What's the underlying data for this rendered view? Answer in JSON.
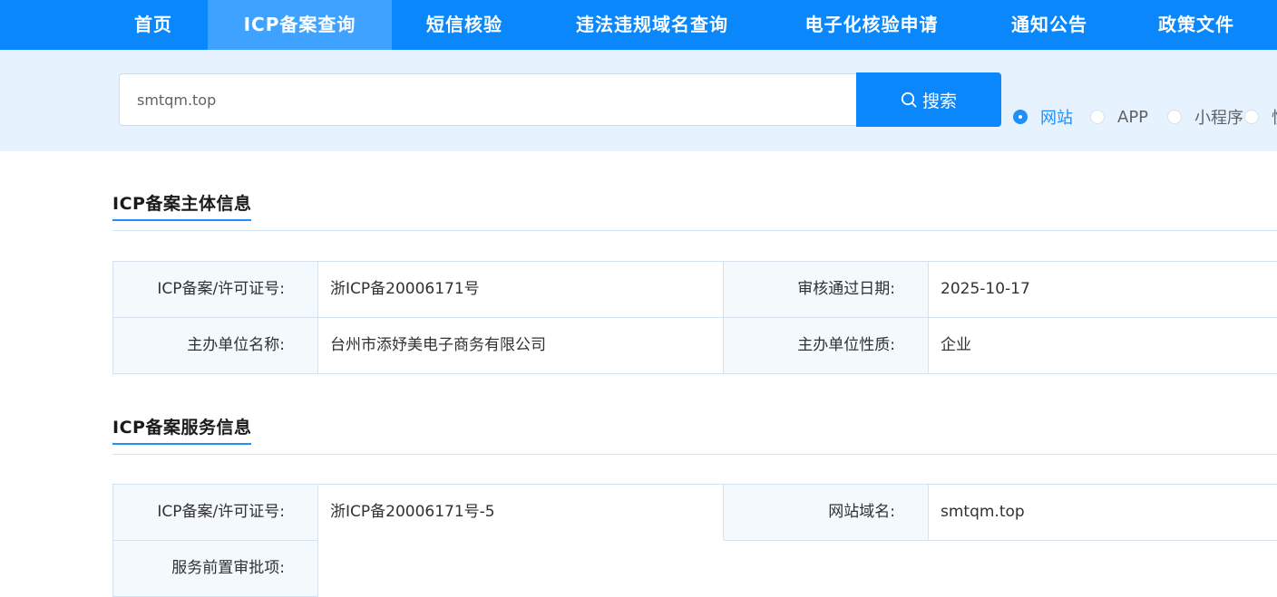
{
  "nav": {
    "items": [
      {
        "label": "首页"
      },
      {
        "label": "ICP备案查询"
      },
      {
        "label": "短信核验"
      },
      {
        "label": "违法违规域名查询"
      },
      {
        "label": "电子化核验申请"
      },
      {
        "label": "通知公告"
      },
      {
        "label": "政策文件"
      }
    ],
    "active_index": 1
  },
  "search": {
    "value": "smtqm.top",
    "button_label": "搜索",
    "types": [
      {
        "label": "网站",
        "checked": true
      },
      {
        "label": "APP",
        "checked": false
      },
      {
        "label": "小程序",
        "checked": false
      },
      {
        "label": "快",
        "checked": false
      }
    ]
  },
  "subject": {
    "title": "ICP备案主体信息",
    "license_label": "ICP备案/许可证号:",
    "license_value": "浙ICP备20006171号",
    "date_label": "审核通过日期:",
    "date_value": "2025-10-17",
    "org_name_label": "主办单位名称:",
    "org_name_value": "台州市添妤美电子商务有限公司",
    "org_type_label": "主办单位性质:",
    "org_type_value": "企业"
  },
  "service": {
    "title": "ICP备案服务信息",
    "license_label": "ICP备案/许可证号:",
    "license_value": "浙ICP备20006171号-5",
    "domain_label": "网站域名:",
    "domain_value": "smtqm.top",
    "preapproval_label": "服务前置审批项:",
    "preapproval_value": ""
  },
  "colors": {
    "nav_bg": "#0a87fb",
    "nav_active_bg": "#3fa2ff",
    "search_band_bg": "#e6f2fd",
    "accent": "#1e8ffb",
    "label_cell_bg": "#f4f9fd",
    "border": "#d5e2ee"
  }
}
